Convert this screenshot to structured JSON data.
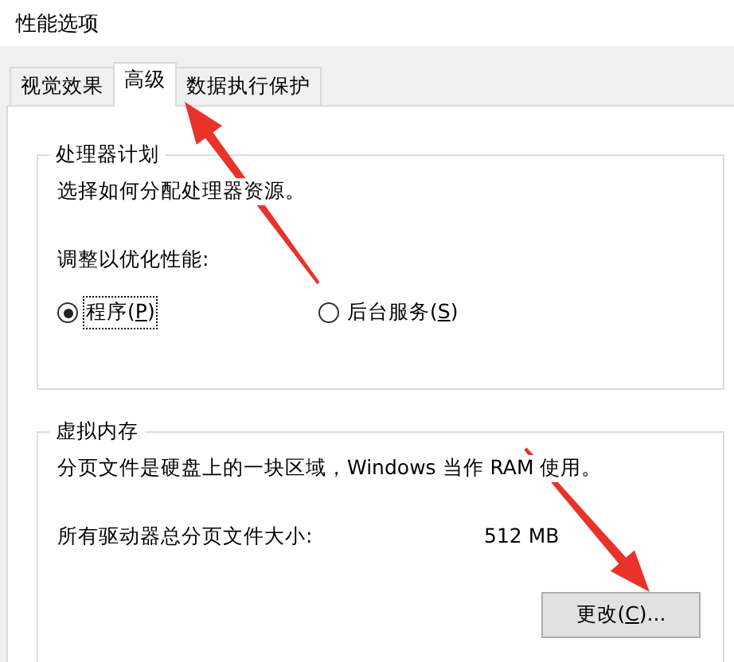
{
  "window": {
    "title": "性能选项"
  },
  "tabs": [
    {
      "label": "视觉效果",
      "selected": false
    },
    {
      "label": "高级",
      "selected": true
    },
    {
      "label": "数据执行保护",
      "selected": false
    }
  ],
  "processor_group": {
    "title": "处理器计划",
    "description": "选择如何分配处理器资源。",
    "adjust_label": "调整以优化性能:",
    "options": [
      {
        "label_before": "程序(",
        "access_key": "P",
        "label_after": ")",
        "selected": true,
        "focused": true
      },
      {
        "label_before": "后台服务(",
        "access_key": "S",
        "label_after": ")",
        "selected": false,
        "focused": false
      }
    ]
  },
  "memory_group": {
    "title": "虚拟内存",
    "description": "分页文件是硬盘上的一块区域，Windows 当作 RAM 使用。",
    "total_label": "所有驱动器总分页文件大小:",
    "total_value": "512 MB",
    "button": {
      "label_before": "更改(",
      "access_key": "C",
      "label_after": ")..."
    }
  },
  "annotations": [
    {
      "kind": "arrow"
    },
    {
      "kind": "arrow"
    }
  ]
}
